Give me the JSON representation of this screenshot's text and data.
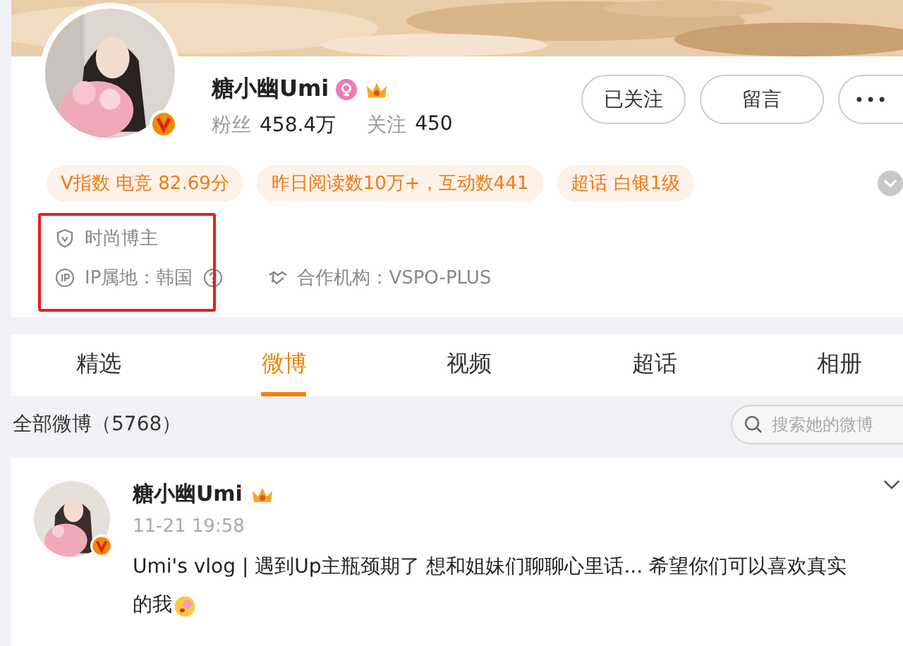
{
  "profile": {
    "name": "糖小幽Umi",
    "fans_label": "粉丝",
    "fans": "458.4万",
    "following_label": "关注",
    "following": "450",
    "buttons": [
      {
        "label": "已关注",
        "kind": "text"
      },
      {
        "label": "留言",
        "kind": "text"
      },
      {
        "label": "•••",
        "kind": "more"
      }
    ],
    "tags": [
      "V指数 电竞 82.69分",
      "昨日阅读数10万+，互动数441",
      "超话 白银1级"
    ],
    "info": [
      {
        "kind": "shield",
        "text": "时尚博主"
      },
      {
        "kind": "ip",
        "text": "IP属地：韩国",
        "help": true
      },
      {
        "kind": "org",
        "text": "合作机构：VSPO-PLUS"
      }
    ]
  },
  "tabs": [
    {
      "label": "精选",
      "selected": false
    },
    {
      "label": "微博",
      "selected": true
    },
    {
      "label": "视频",
      "selected": false
    },
    {
      "label": "超话",
      "selected": false
    },
    {
      "label": "相册",
      "selected": false
    }
  ],
  "feed": {
    "title": "全部微博（5768）",
    "search": {
      "placeholder": "搜索她的微博"
    }
  },
  "post": {
    "name": "糖小幽Umi",
    "time": "11-21 19:58",
    "text_lines": [
      "Umi's vlog | 遇到Up主瓶颈期了 想和姐妹们聊聊心里话... 希望你们可以喜欢真实",
      "的我"
    ]
  }
}
